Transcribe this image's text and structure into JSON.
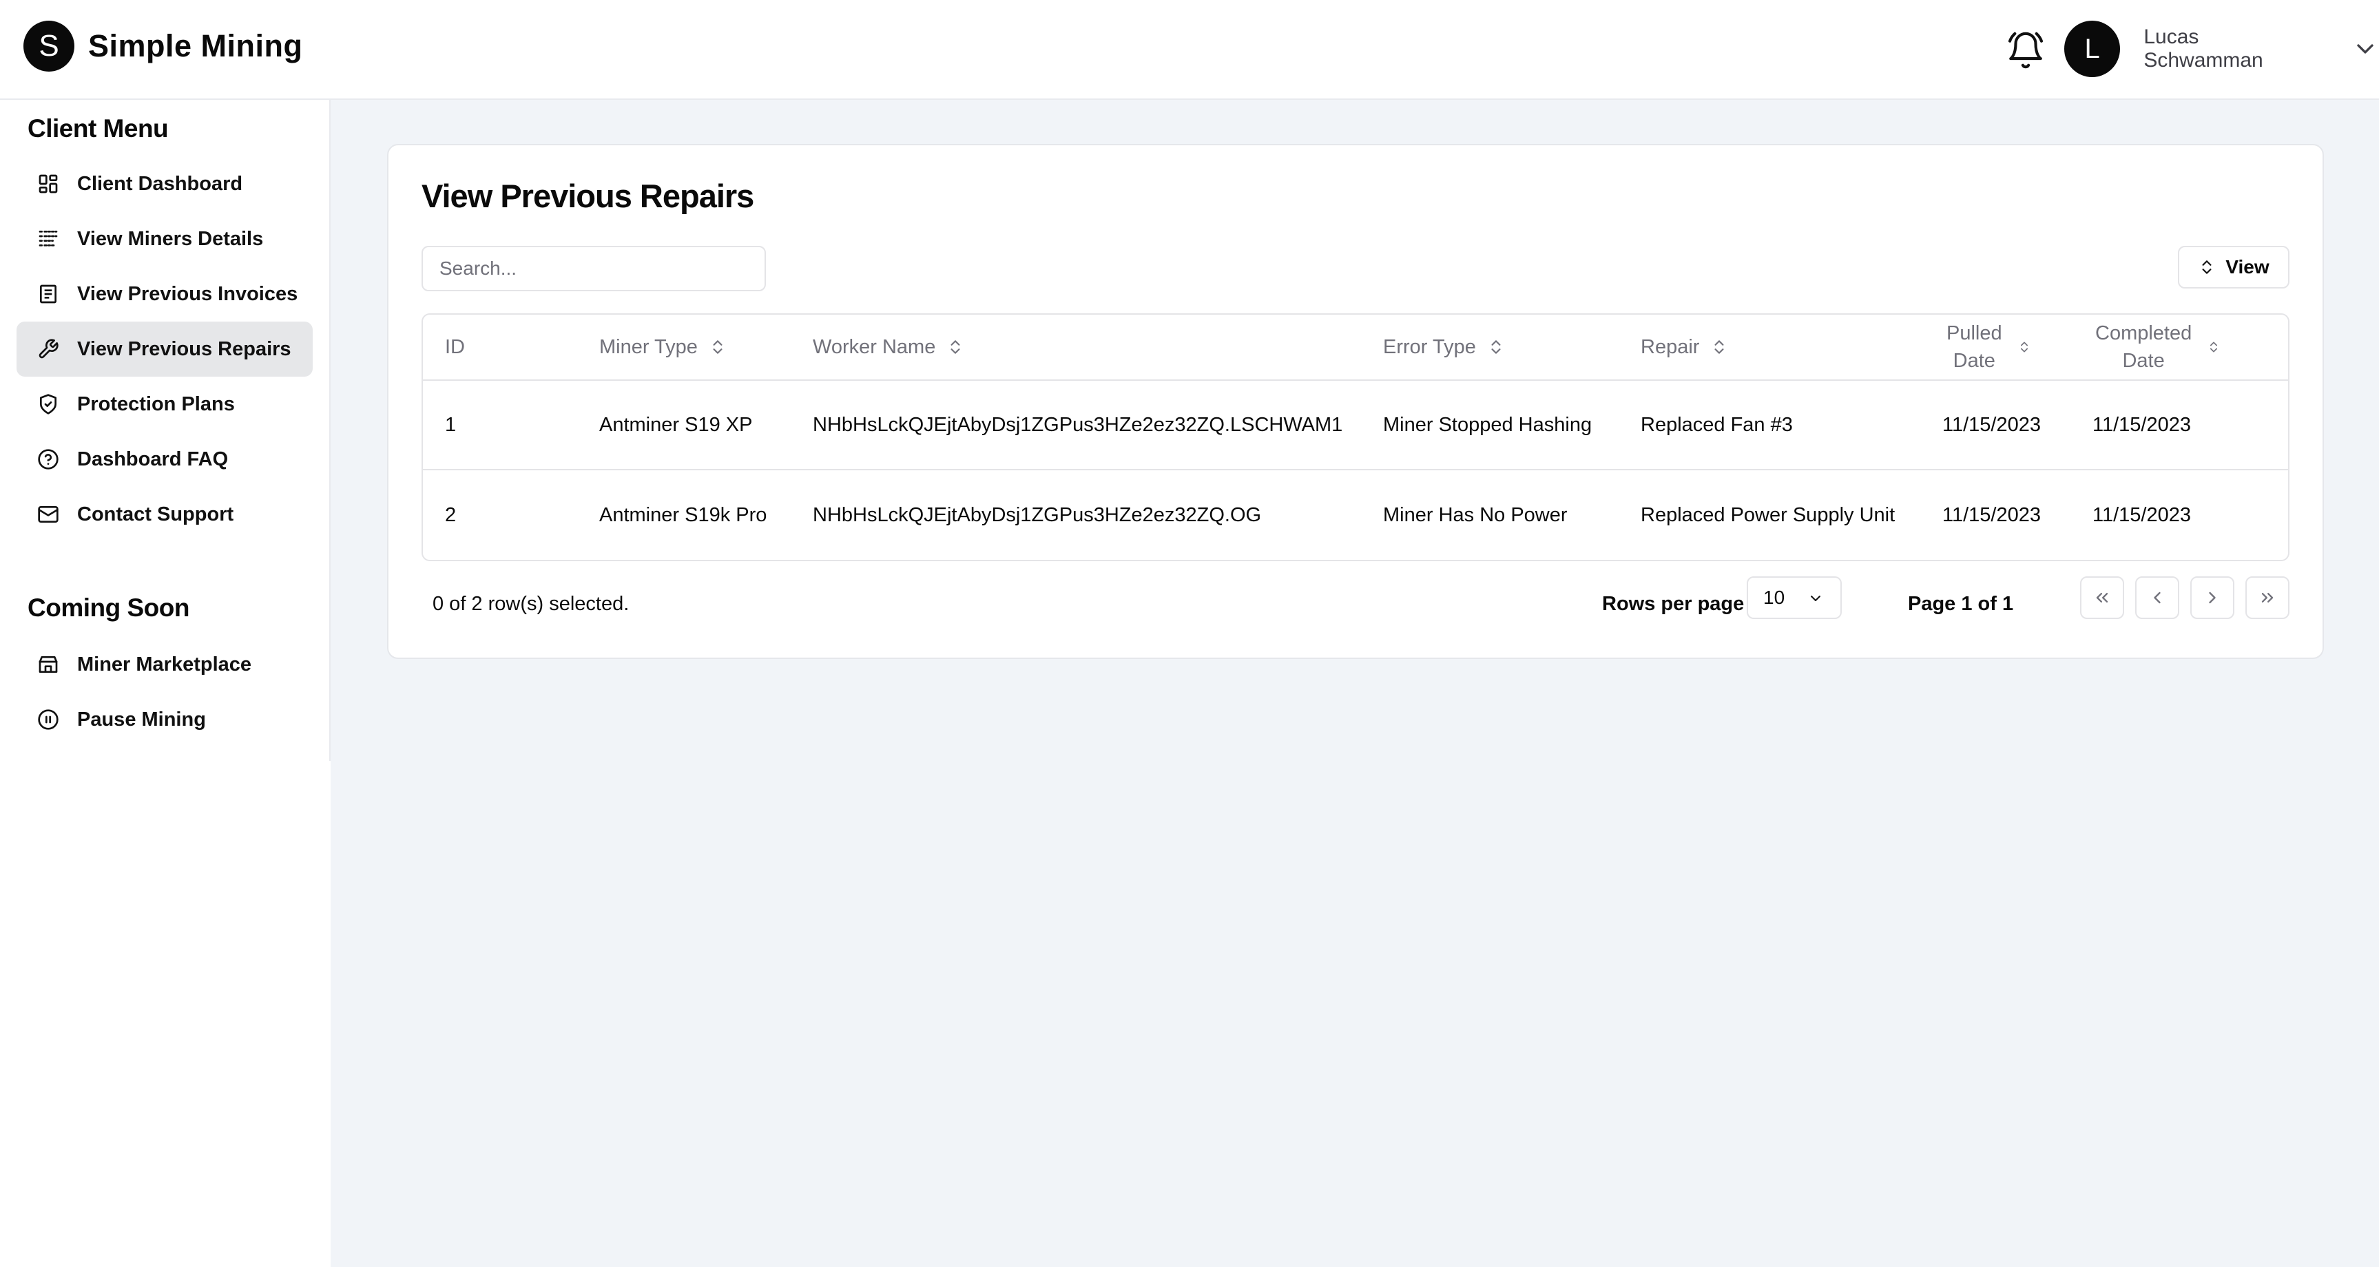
{
  "header": {
    "logo_initial": "S",
    "brand": "Simple Mining",
    "user_initial": "L",
    "user_name": "Lucas Schwamman",
    "icons": [
      "bell-icon",
      "chevron-down-icon"
    ]
  },
  "sidebar": {
    "client_menu_title": "Client Menu",
    "client_items": [
      {
        "label": "Client Dashboard",
        "icon": "dashboard-grid-icon"
      },
      {
        "label": "View Miners Details",
        "icon": "list-details-icon"
      },
      {
        "label": "View Previous Invoices",
        "icon": "invoice-icon"
      },
      {
        "label": "View Previous Repairs",
        "icon": "wrench-icon",
        "active": true
      },
      {
        "label": "Protection Plans",
        "icon": "shield-check-icon"
      },
      {
        "label": "Dashboard FAQ",
        "icon": "help-circle-icon"
      },
      {
        "label": "Contact Support",
        "icon": "mail-icon"
      }
    ],
    "coming_soon_title": "Coming Soon",
    "coming_soon_items": [
      {
        "label": "Miner Marketplace",
        "icon": "store-icon"
      },
      {
        "label": "Pause Mining",
        "icon": "pause-circle-icon"
      }
    ]
  },
  "main": {
    "title": "View Previous Repairs",
    "search_placeholder": "Search...",
    "view_button": "View",
    "table": {
      "columns": {
        "id": "ID",
        "miner_type": "Miner Type",
        "worker_name": "Worker Name",
        "error_type": "Error Type",
        "repair": "Repair",
        "pulled_1": "Pulled",
        "pulled_2": "Date",
        "completed_1": "Completed",
        "completed_2": "Date"
      },
      "rows": [
        {
          "id": "1",
          "miner_type": "Antminer S19 XP",
          "worker_name": "NHbHsLckQJEjtAbyDsj1ZGPus3HZe2ez32ZQ.LSCHWAM1",
          "error_type": "Miner Stopped Hashing",
          "repair": "Replaced Fan #3",
          "pulled_date": "11/15/2023",
          "completed_date": "11/15/2023"
        },
        {
          "id": "2",
          "miner_type": "Antminer S19k Pro",
          "worker_name": "NHbHsLckQJEjtAbyDsj1ZGPus3HZe2ez32ZQ.OG",
          "error_type": "Miner Has No Power",
          "repair": "Replaced Power Supply Unit",
          "pulled_date": "11/15/2023",
          "completed_date": "11/15/2023"
        }
      ]
    },
    "footer": {
      "selected": "0 of 2 row(s) selected.",
      "rows_per_page_label": "Rows per page",
      "rows_per_page_value": "10",
      "page_label": "Page 1 of 1"
    }
  },
  "colors": {
    "background": "#f1f4f8",
    "card": "#ffffff",
    "active_nav": "#e6e7e9",
    "border": "#e4e4e7",
    "muted_text": "#71717a"
  }
}
